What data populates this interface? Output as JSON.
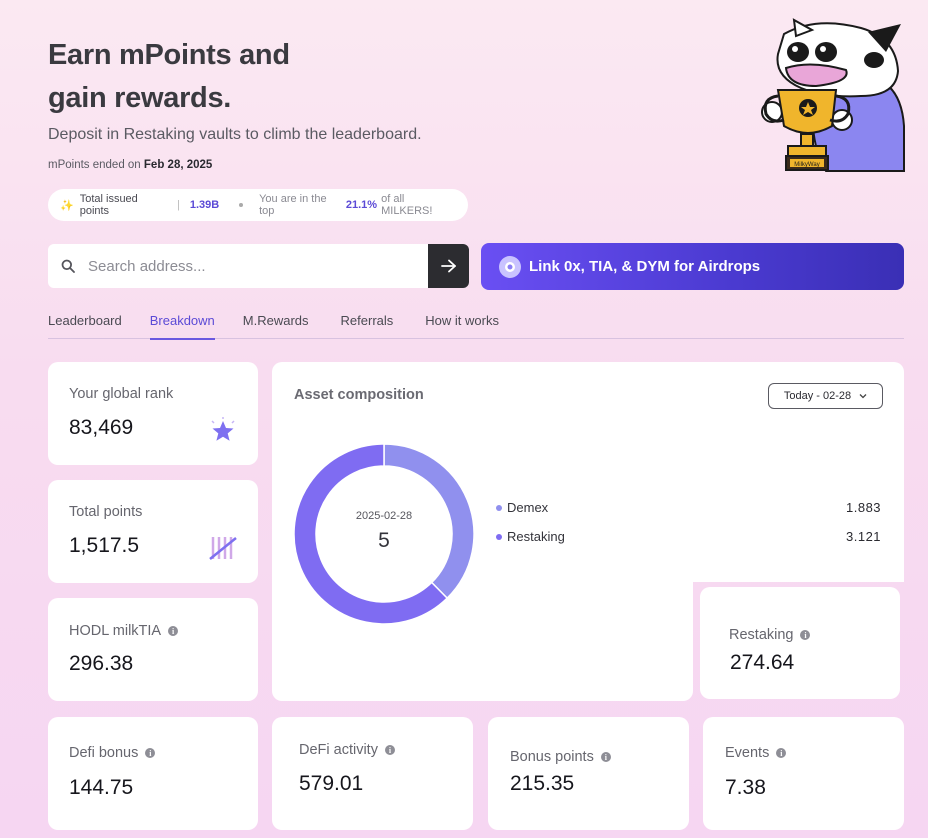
{
  "header": {
    "title_line1": "Earn mPoints and",
    "title_line2": "gain rewards.",
    "subtitle": "Deposit in Restaking vaults to climb the leaderboard.",
    "ended_prefix": "mPoints ended on",
    "ended_date": "Feb 28, 2025"
  },
  "stats_pill": {
    "sparkle": "✨",
    "issued_label": "Total issued points",
    "issued_value": "1.39B",
    "rank_prefix": "You are in the top",
    "rank_value": "21.1%",
    "rank_suffix": "of all MILKERS!"
  },
  "mascot": {
    "badge_text": "MilkyWay"
  },
  "search": {
    "placeholder": "Search address..."
  },
  "link_button": {
    "label": "Link 0x, TIA, & DYM for Airdrops"
  },
  "tabs": [
    {
      "label": "Leaderboard",
      "active": false
    },
    {
      "label": "Breakdown",
      "active": true
    },
    {
      "label": "M.Rewards",
      "active": false
    },
    {
      "label": "Referrals",
      "active": false
    },
    {
      "label": "How it works",
      "active": false
    }
  ],
  "cards": {
    "global_rank": {
      "label": "Your global rank",
      "value": "83,469"
    },
    "total_points": {
      "label": "Total points",
      "value": "1,517.5"
    },
    "hodl": {
      "label": "HODL milkTIA",
      "value": "296.38"
    },
    "restaking": {
      "label": "Restaking",
      "value": "274.64"
    },
    "defi_bonus": {
      "label": "Defi bonus",
      "value": "144.75"
    },
    "defi_activity": {
      "label": "DeFi activity",
      "value": "579.01"
    },
    "bonus_points": {
      "label": "Bonus points",
      "value": "215.35"
    },
    "events": {
      "label": "Events",
      "value": "7.38"
    }
  },
  "asset_composition": {
    "title": "Asset composition",
    "date_range": "Today - 02-28",
    "center_date": "2025-02-28",
    "center_value": "5",
    "colors": {
      "demex": "#9090ee",
      "restaking": "#7f6cf2"
    }
  },
  "chart_data": {
    "type": "pie",
    "categories": [
      "Demex",
      "Restaking"
    ],
    "values": [
      1.883,
      3.121
    ],
    "labels": [
      "1.883",
      "3.121"
    ]
  }
}
